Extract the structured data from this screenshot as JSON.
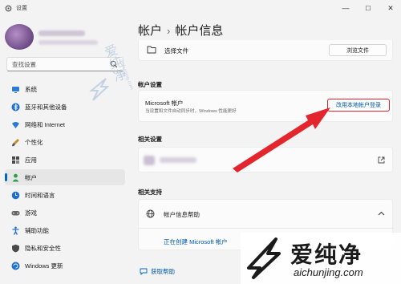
{
  "window": {
    "title": "设置",
    "minimize": "—",
    "maximize": "☐",
    "close": "✕"
  },
  "search": {
    "placeholder": "查找设置"
  },
  "nav": [
    {
      "label": "系统",
      "icon": "monitor-icon",
      "color": "#2b7bd4"
    },
    {
      "label": "蓝牙和其他设备",
      "icon": "bluetooth-icon",
      "color": "#1f6fd1"
    },
    {
      "label": "网络和 Internet",
      "icon": "wifi-icon",
      "color": "#2b7bd4"
    },
    {
      "label": "个性化",
      "icon": "brush-icon",
      "color": "#c58a2a"
    },
    {
      "label": "应用",
      "icon": "apps-icon",
      "color": "#4a4a4a"
    },
    {
      "label": "帐户",
      "icon": "person-icon",
      "color": "#2e9d4a",
      "active": true
    },
    {
      "label": "时间和语言",
      "icon": "globe-clock-icon",
      "color": "#1f6fd1"
    },
    {
      "label": "游戏",
      "icon": "gamepad-icon",
      "color": "#666666"
    },
    {
      "label": "辅助功能",
      "icon": "accessibility-icon",
      "color": "#1f6fd1"
    },
    {
      "label": "隐私和安全性",
      "icon": "shield-icon",
      "color": "#4a4a4a"
    },
    {
      "label": "Windows 更新",
      "icon": "update-icon",
      "color": "#1f6fd1"
    }
  ],
  "breadcrumb": {
    "parent": "帐户",
    "separator": "›",
    "current": "帐户信息"
  },
  "choose_file": {
    "label": "选择文件",
    "button": "浏览文件"
  },
  "account_settings": {
    "title": "帐户设置",
    "name": "Microsoft 帐户",
    "desc": "当设置和文件自动同步时，Windows 性能更好",
    "button": "改用本地帐户登录"
  },
  "related_settings": {
    "title": "相关设置"
  },
  "related_support": {
    "title": "相关支持",
    "help_title": "帐户信息帮助",
    "link": "正在创建 Microsoft 帐户"
  },
  "footer": {
    "help": "获取帮助"
  },
  "watermark": {
    "brand": "爱纯净",
    "url": "aichunjing.com"
  },
  "colors": {
    "accent": "#0067c0",
    "highlight": "#e0202a",
    "arrow": "#e3262e"
  }
}
